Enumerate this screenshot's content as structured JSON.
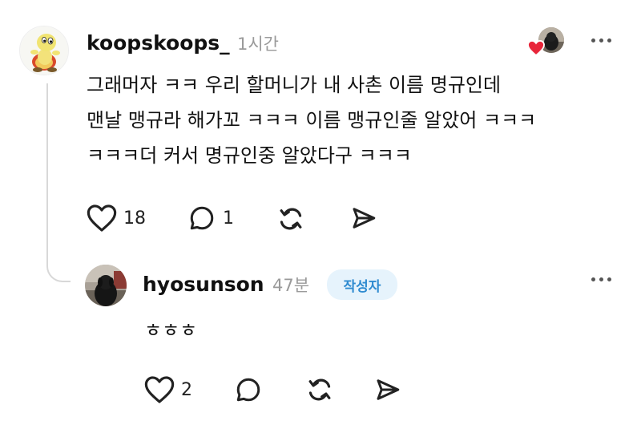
{
  "comment": {
    "username": "koopskoops_",
    "time": "1시간",
    "lines": [
      "그래머자 ㅋㅋ 우리 할머니가 내 사촌 이름 명규인데",
      "맨날 맹규라 해가꼬 ㅋㅋㅋ 이름 맹규인줄 알았어 ㅋㅋㅋ",
      "ㅋㅋㅋ더 커서 명규인중 알았다구 ㅋㅋㅋ"
    ],
    "like_count": "18",
    "reply_count": "1",
    "icons": {
      "avatar": "turtle-avatar-icon",
      "liked_by": "author-liked-heart-icon",
      "more": "more-options-icon",
      "like": "heart-icon",
      "reply": "comment-bubble-icon",
      "repost": "repost-icon",
      "share": "send-icon"
    }
  },
  "reply": {
    "username": "hyosunson",
    "time": "47분",
    "badge": "작성자",
    "text": "ㅎㅎㅎ",
    "like_count": "2",
    "icons": {
      "avatar": "dog-avatar-icon",
      "more": "more-options-icon",
      "like": "heart-icon",
      "reply": "comment-bubble-icon",
      "repost": "repost-icon",
      "share": "send-icon"
    }
  },
  "colors": {
    "badge_bg": "#e6f3fc",
    "badge_text": "#2f8bd0",
    "muted": "#9a9a9a",
    "heart_red": "#e8253a"
  }
}
